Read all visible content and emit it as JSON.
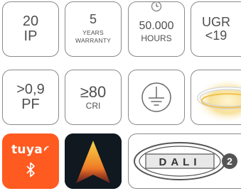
{
  "tiles": {
    "ip": {
      "value": "20",
      "unit": "IP"
    },
    "warranty": {
      "value": "5",
      "line1": "YEARS",
      "line2": "WARRANTY"
    },
    "hours": {
      "value": "50.000",
      "unit": "HOURS"
    },
    "ugr": {
      "label": "UGR",
      "value": "<19"
    },
    "pf": {
      "value": ">0,9",
      "unit": "PF"
    },
    "cri": {
      "value": "≥80",
      "unit": "CRI"
    },
    "tuya": {
      "logo_text": "tuya"
    },
    "dali": {
      "logo_text": "DALI",
      "version": "2"
    }
  },
  "icons": {
    "clock": "clock-icon",
    "ground": "ground-symbol-icon",
    "light": "ring-light-icon",
    "bluetooth": "bluetooth-icon",
    "app": "app-logo-icon"
  },
  "colors": {
    "tile_border": "#8a8a8a",
    "text": "#4f4f4f",
    "tuya_orange": "#ff5a1f",
    "app_background": "#101820",
    "app_gradient_top": "#f7d24a",
    "app_gradient_bottom": "#e0391e"
  }
}
